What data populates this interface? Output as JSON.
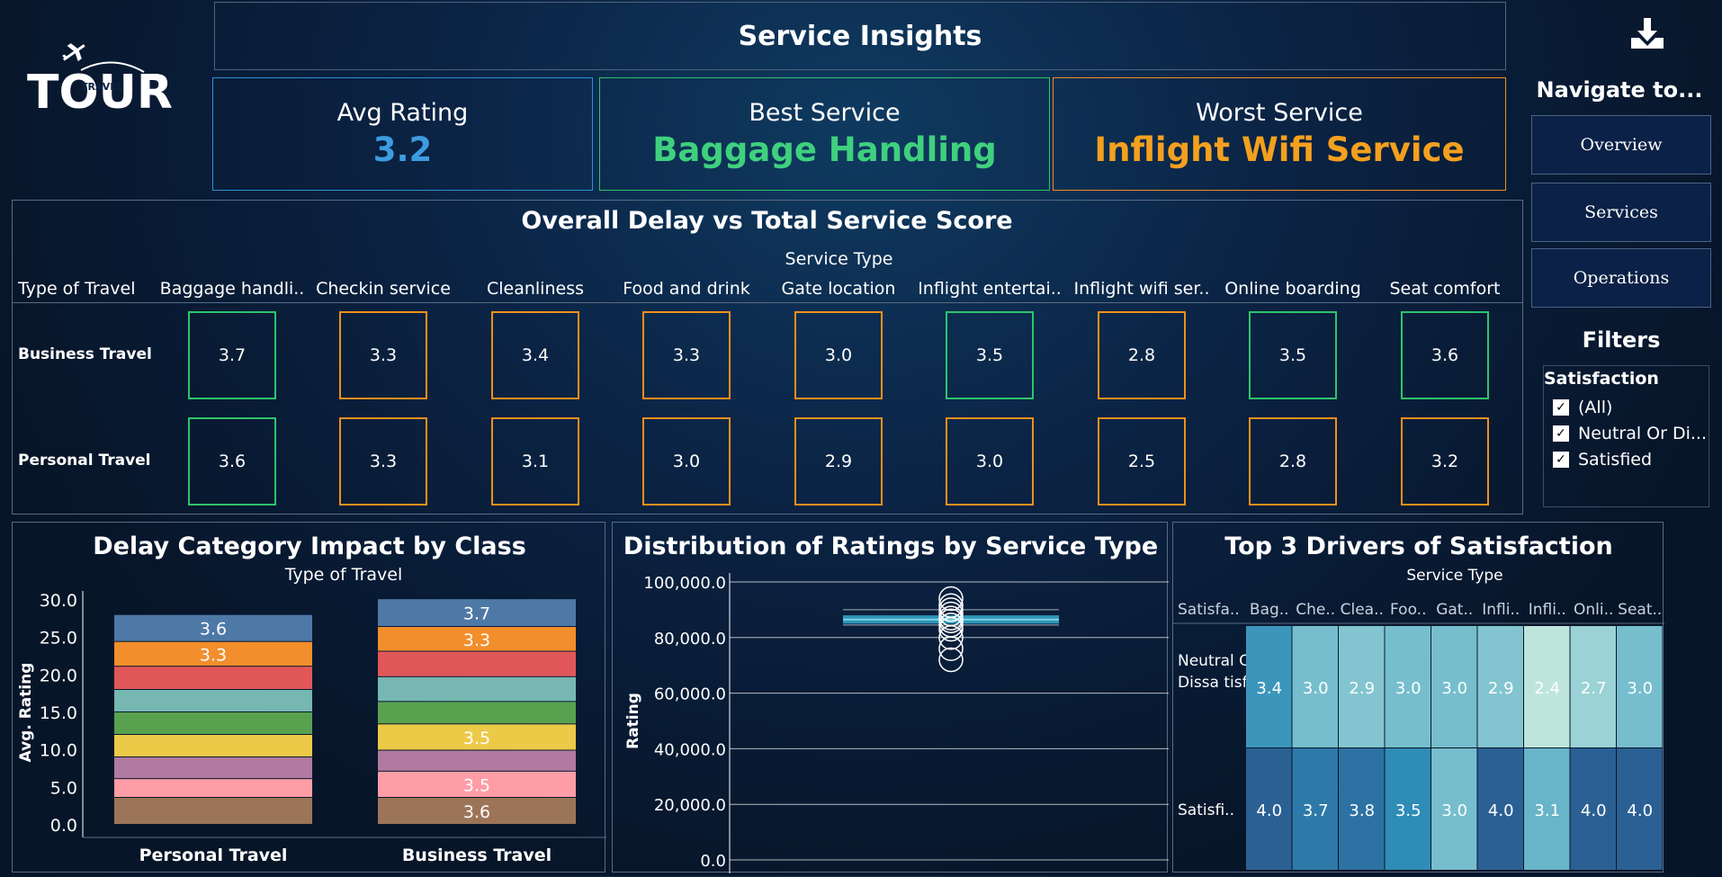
{
  "header": {
    "title": "Service Insights"
  },
  "logo": {
    "text": "TOUR",
    "subtext": "TRAVEL"
  },
  "kpis": {
    "avg_rating": {
      "label": "Avg Rating",
      "value": "3.2"
    },
    "best_service": {
      "label": "Best Service",
      "value": "Baggage Handling"
    },
    "worst_service": {
      "label": "Worst Service",
      "value": "Inflight Wifi Service"
    }
  },
  "nav": {
    "title": "Navigate to...",
    "buttons": [
      "Overview",
      "Services",
      "Operations"
    ]
  },
  "filters": {
    "title": "Filters",
    "heading": "Satisfaction",
    "options": [
      "(All)",
      "Neutral Or Di...",
      "Satisfied"
    ]
  },
  "colors": {
    "good": "#2ec46b",
    "bad": "#f0901a",
    "accent_blue": "#3d9ce0"
  },
  "delay_section": {
    "title": "Overall Delay vs Total Service Score",
    "column_group_label": "Service Type",
    "row_group_label": "Type of Travel",
    "columns": [
      "Baggage handli..",
      "Checkin service",
      "Cleanliness",
      "Food and drink",
      "Gate location",
      "Inflight entertai..",
      "Inflight wifi ser..",
      "Online boarding",
      "Seat comfort"
    ],
    "rows": [
      {
        "label": "Business Travel",
        "values": [
          "3.7",
          "3.3",
          "3.4",
          "3.3",
          "3.0",
          "3.5",
          "2.8",
          "3.5",
          "3.6"
        ],
        "status": [
          "good",
          "bad",
          "bad",
          "bad",
          "bad",
          "good",
          "bad",
          "good",
          "good"
        ]
      },
      {
        "label": "Personal Travel",
        "values": [
          "3.6",
          "3.3",
          "3.1",
          "3.0",
          "2.9",
          "3.0",
          "2.5",
          "2.8",
          "3.2"
        ],
        "status": [
          "good",
          "bad",
          "bad",
          "bad",
          "bad",
          "bad",
          "bad",
          "bad",
          "bad"
        ]
      }
    ]
  },
  "chart_data": [
    {
      "type": "bar",
      "stacked": true,
      "title": "Delay Category Impact by Class",
      "subtitle": "Type of Travel",
      "ylabel": "Avg. Rating",
      "ylim": [
        0,
        30
      ],
      "yticks": [
        "0.0",
        "5.0",
        "10.0",
        "15.0",
        "20.0",
        "25.0",
        "30.0"
      ],
      "categories": [
        "Personal Travel",
        "Business Travel"
      ],
      "segment_colors": [
        "#9c7558",
        "#ff9da7",
        "#b07aa1",
        "#edc948",
        "#59a14f",
        "#76b7b2",
        "#e15759",
        "#f28e2b",
        "#4e79a7"
      ],
      "segments": [
        {
          "values": [
            3.6,
            3.6
          ],
          "labels": [
            "",
            "3.6"
          ]
        },
        {
          "values": [
            2.5,
            3.5
          ],
          "labels": [
            "",
            "3.5"
          ]
        },
        {
          "values": [
            2.9,
            2.8
          ],
          "labels": [
            "",
            ""
          ]
        },
        {
          "values": [
            3.0,
            3.5
          ],
          "labels": [
            "",
            "3.5"
          ]
        },
        {
          "values": [
            3.0,
            3.0
          ],
          "labels": [
            "",
            ""
          ]
        },
        {
          "values": [
            3.0,
            3.3
          ],
          "labels": [
            "",
            ""
          ]
        },
        {
          "values": [
            3.1,
            3.4
          ],
          "labels": [
            "",
            ""
          ]
        },
        {
          "values": [
            3.3,
            3.3
          ],
          "labels": [
            "3.3",
            "3.3"
          ]
        },
        {
          "values": [
            3.6,
            3.7
          ],
          "labels": [
            "3.6",
            "3.7"
          ]
        }
      ]
    },
    {
      "type": "box",
      "title": "Distribution of Ratings by Service Type",
      "ylabel": "Rating",
      "ylim": [
        0,
        100000
      ],
      "yticks": [
        "0.0",
        "20,000.0",
        "40,000.0",
        "60,000.0",
        "80,000.0",
        "100,000.0"
      ],
      "box": {
        "whisker_low": 84500,
        "q1": 85000,
        "median": 86500,
        "q3": 88000,
        "whisker_high": 90000
      },
      "points": [
        72000,
        76000,
        80000,
        83000,
        84500,
        86000,
        87000,
        88500,
        90000,
        91500,
        94000
      ]
    },
    {
      "type": "heatmap",
      "title": "Top 3 Drivers of Satisfaction",
      "subtitle": "Service Type",
      "row_header": "Satisfa..",
      "columns": [
        "Bag..",
        "Che..",
        "Clea..",
        "Foo..",
        "Gat..",
        "Infli..",
        "Infli..",
        "Onli..",
        "Seat.."
      ],
      "rows": [
        {
          "label": "Neutral Or Dissa tisfied",
          "values": [
            3.4,
            3.0,
            2.9,
            3.0,
            3.0,
            2.9,
            2.4,
            2.7,
            3.0
          ],
          "labels": [
            "3.4",
            "3.0",
            "2.9",
            "3.0",
            "3.0",
            "2.9",
            "2.4",
            "2.7",
            "3.0"
          ]
        },
        {
          "label": "Satisfi..",
          "values": [
            4.0,
            3.7,
            3.8,
            3.5,
            3.0,
            4.0,
            3.1,
            4.0,
            4.0
          ],
          "labels": [
            "4.0",
            "3.7",
            "3.8",
            "3.5",
            "3.0",
            "4.0",
            "3.1",
            "4.0",
            "4.0"
          ]
        }
      ]
    }
  ]
}
